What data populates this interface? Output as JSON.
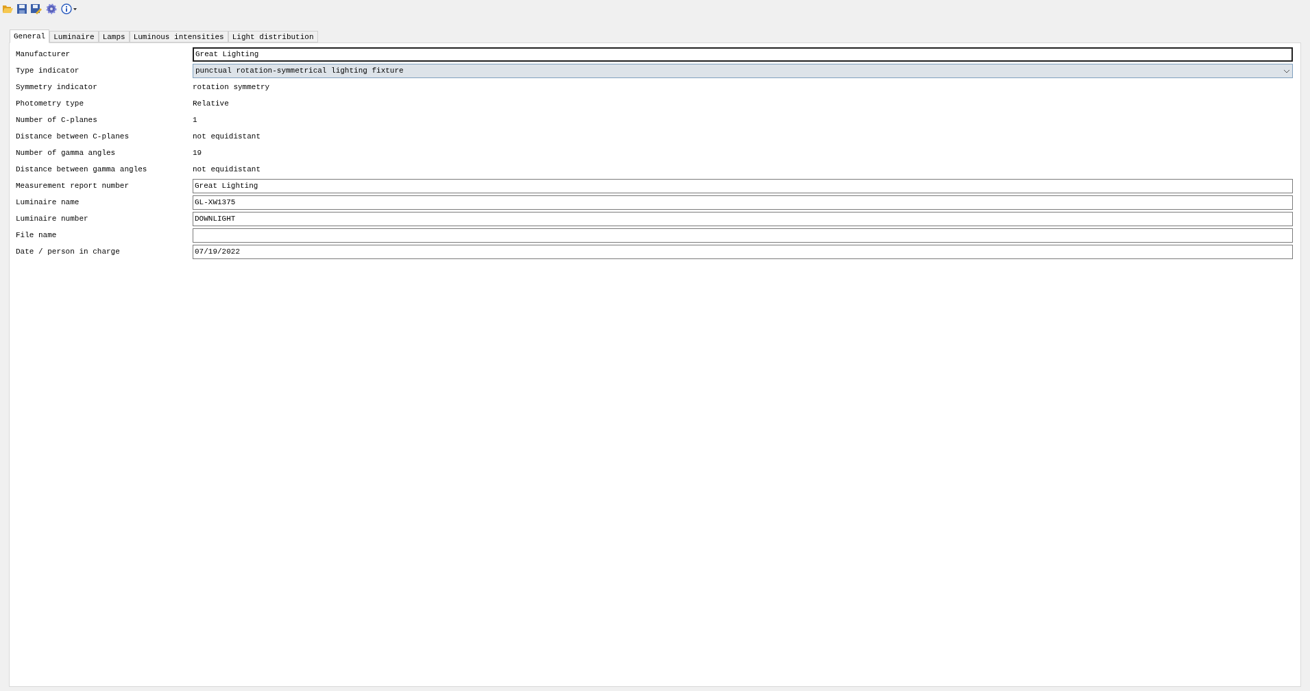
{
  "toolbar": [
    {
      "kind": "open"
    },
    {
      "kind": "save"
    },
    {
      "kind": "save-as"
    },
    {
      "kind": "settings"
    },
    {
      "kind": "info"
    }
  ],
  "tabs": [
    {
      "label": "General",
      "selected": true
    },
    {
      "label": "Luminaire",
      "selected": false
    },
    {
      "label": "Lamps",
      "selected": false
    },
    {
      "label": "Luminous intensities",
      "selected": false
    },
    {
      "label": "Light distribution",
      "selected": false
    }
  ],
  "fields": [
    {
      "label": "Manufacturer",
      "kind": "input",
      "value": "Great Lighting",
      "focused": true
    },
    {
      "label": "Type indicator",
      "kind": "combo",
      "value": "punctual rotation-symmetrical lighting fixture"
    },
    {
      "label": "Symmetry indicator",
      "kind": "static",
      "value": "rotation symmetry"
    },
    {
      "label": "Photometry type",
      "kind": "static",
      "value": "Relative"
    },
    {
      "label": "Number of C-planes",
      "kind": "static",
      "value": "1"
    },
    {
      "label": "Distance between C-planes",
      "kind": "static",
      "value": "not equidistant"
    },
    {
      "label": "Number of gamma angles",
      "kind": "static",
      "value": "19"
    },
    {
      "label": "Distance between gamma angles",
      "kind": "static",
      "value": "not equidistant"
    },
    {
      "label": "Measurement report number",
      "kind": "input",
      "value": "Great Lighting",
      "focused": false
    },
    {
      "label": "Luminaire name",
      "kind": "input",
      "value": "GL-XW1375",
      "focused": false
    },
    {
      "label": "Luminaire number",
      "kind": "input",
      "value": "DOWNLIGHT",
      "focused": false
    },
    {
      "label": "File name",
      "kind": "input",
      "focused": false
    },
    {
      "label": "Date / person in charge",
      "kind": "input",
      "value": "07/19/2022",
      "focused": false
    }
  ]
}
